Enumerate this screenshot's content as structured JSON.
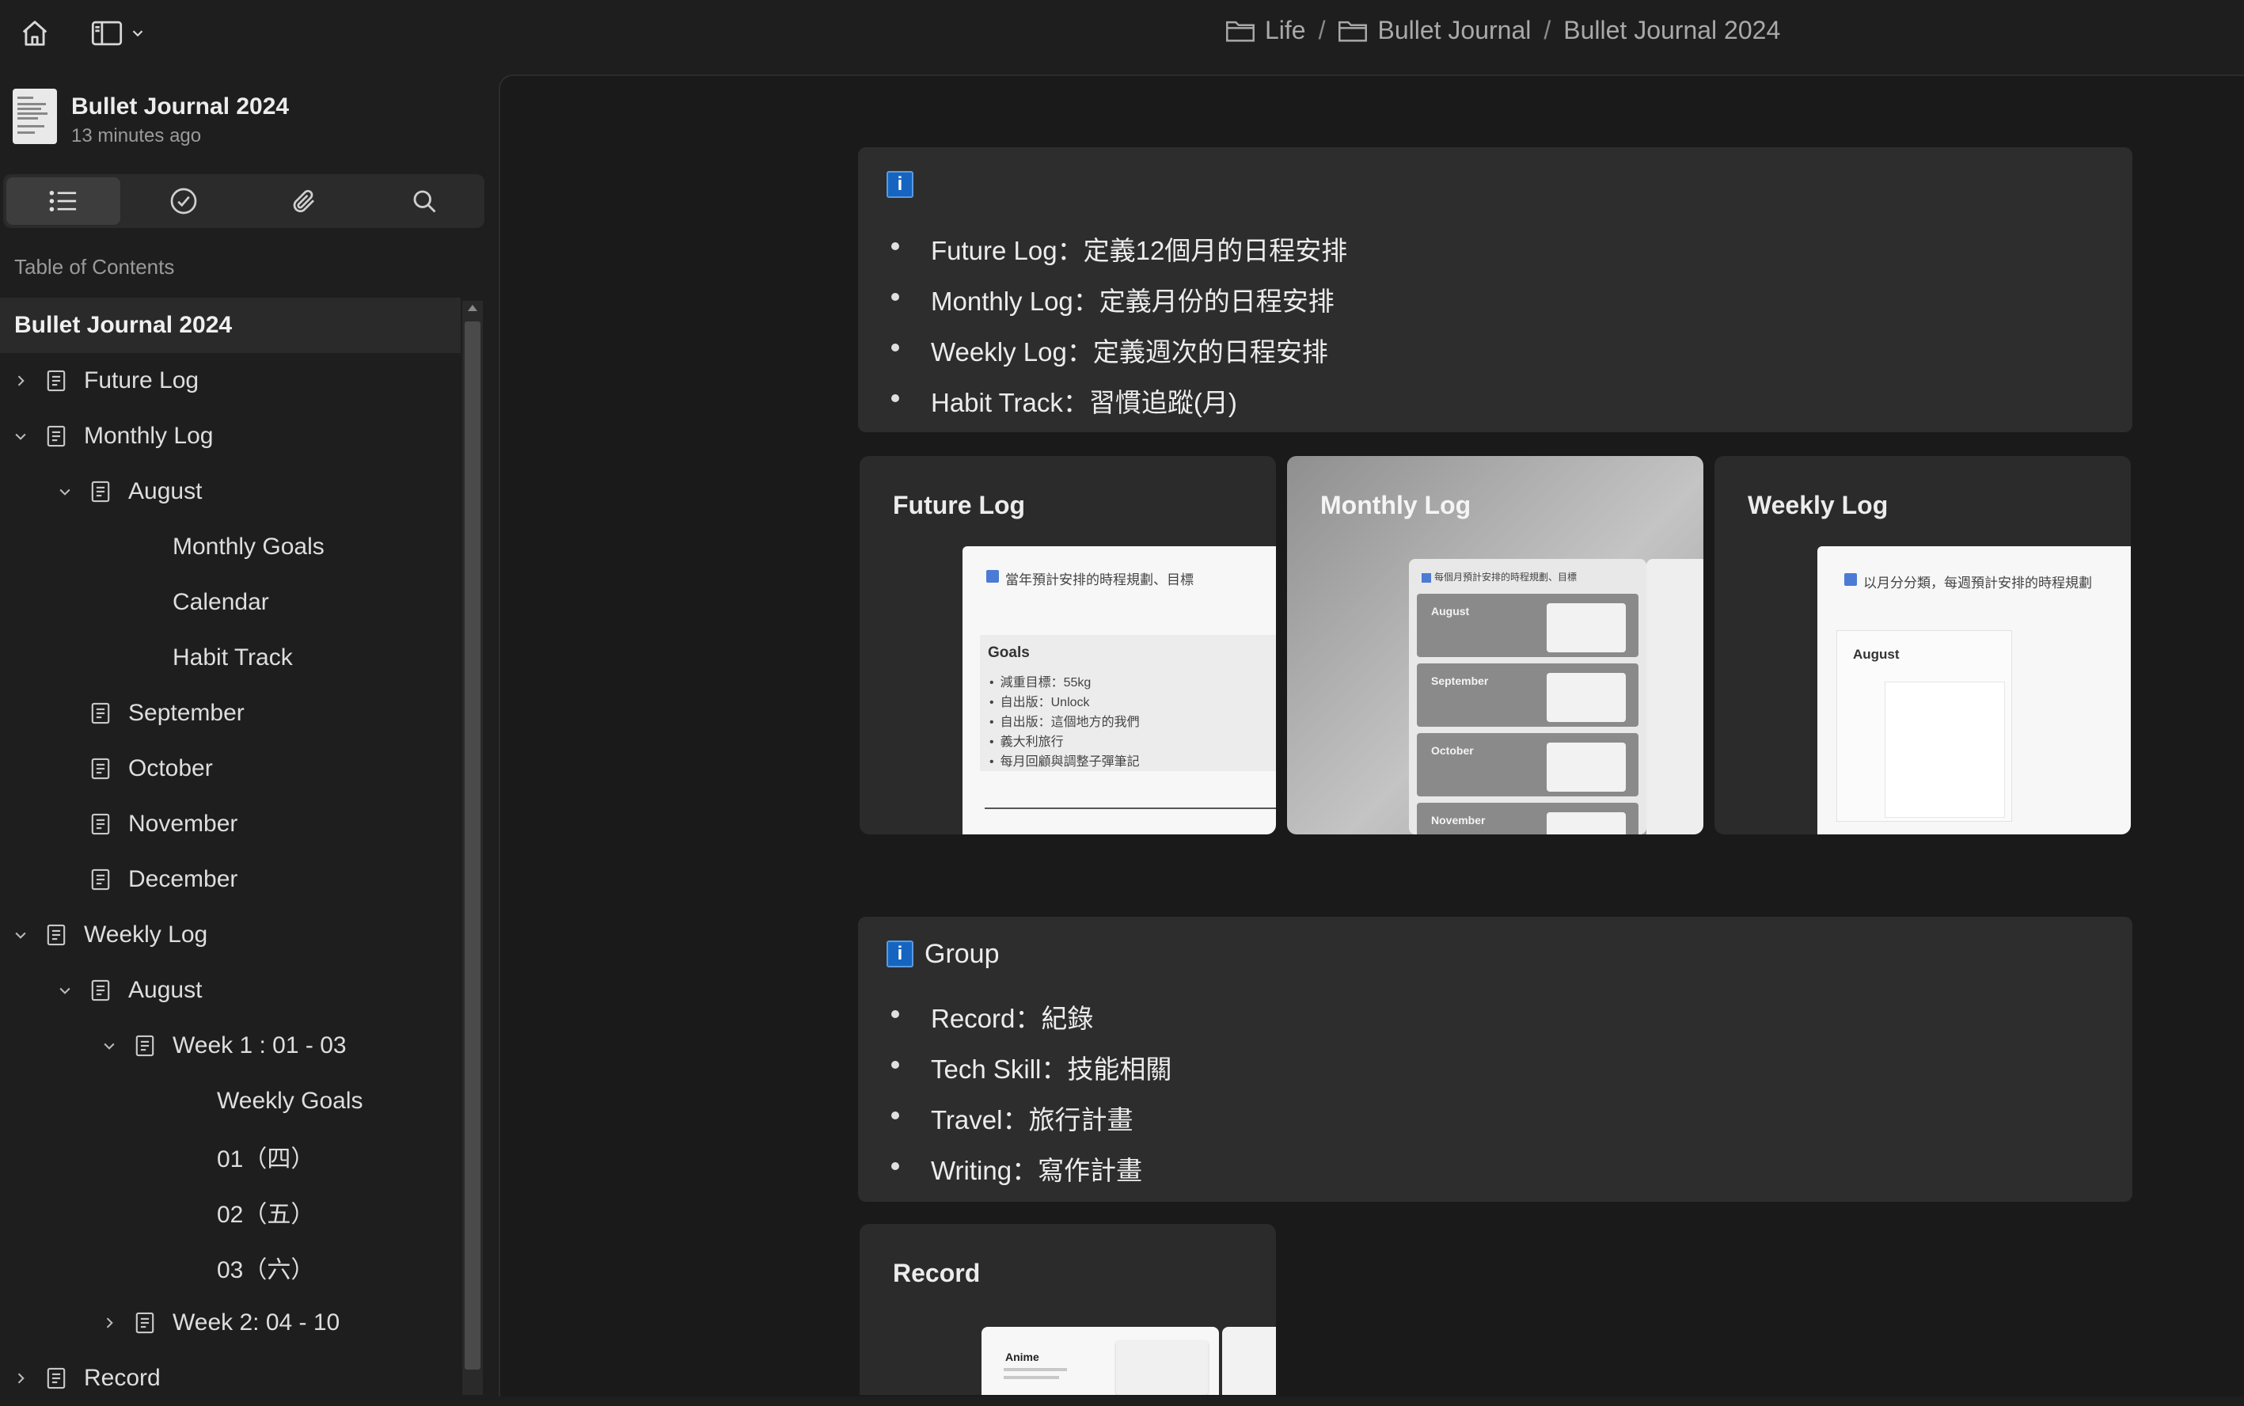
{
  "breadcrumb": [
    "Life",
    "Bullet Journal",
    "Bullet Journal 2024"
  ],
  "document": {
    "title": "Bullet Journal 2024",
    "updated": "13 minutes ago"
  },
  "sidebar": {
    "toc_label": "Table of Contents",
    "tabs": [
      "list-icon",
      "check-circle-icon",
      "paperclip-icon",
      "search-icon"
    ],
    "items": [
      {
        "label": "Bullet Journal 2024",
        "depth": 0,
        "expand": "none",
        "icon": false
      },
      {
        "label": "Future Log",
        "depth": 1,
        "expand": "collapsed",
        "icon": true
      },
      {
        "label": "Monthly Log",
        "depth": 1,
        "expand": "expanded",
        "icon": true
      },
      {
        "label": "August",
        "depth": 2,
        "expand": "expanded",
        "icon": true
      },
      {
        "label": "Monthly Goals",
        "depth": 3,
        "expand": "none",
        "icon": false
      },
      {
        "label": "Calendar",
        "depth": 3,
        "expand": "none",
        "icon": false
      },
      {
        "label": "Habit Track",
        "depth": 3,
        "expand": "none",
        "icon": false
      },
      {
        "label": "September",
        "depth": 2,
        "expand": "none",
        "icon": true
      },
      {
        "label": "October",
        "depth": 2,
        "expand": "none",
        "icon": true
      },
      {
        "label": "November",
        "depth": 2,
        "expand": "none",
        "icon": true
      },
      {
        "label": "December",
        "depth": 2,
        "expand": "none",
        "icon": true
      },
      {
        "label": "Weekly Log",
        "depth": 1,
        "expand": "expanded",
        "icon": true
      },
      {
        "label": "August",
        "depth": 2,
        "expand": "expanded",
        "icon": true
      },
      {
        "label": "Week 1 : 01 - 03",
        "depth": 3,
        "expand": "expanded",
        "icon": true
      },
      {
        "label": "Weekly Goals",
        "depth": 4,
        "expand": "none",
        "icon": false
      },
      {
        "label": "01（四）",
        "depth": 4,
        "expand": "none",
        "icon": false
      },
      {
        "label": "02（五）",
        "depth": 4,
        "expand": "none",
        "icon": false
      },
      {
        "label": "03（六）",
        "depth": 4,
        "expand": "none",
        "icon": false
      },
      {
        "label": "Week 2: 04 - 10",
        "depth": 3,
        "expand": "collapsed",
        "icon": true
      },
      {
        "label": "Record",
        "depth": 1,
        "expand": "collapsed",
        "icon": true
      }
    ]
  },
  "callout1": {
    "badge": "i",
    "items": [
      "Future Log：定義12個月的日程安排",
      "Monthly Log：定義月份的日程安排",
      "Weekly Log：定義週次的日程安排",
      "Habit Track：習慣追蹤(月)"
    ]
  },
  "cards": [
    {
      "title": "Future Log",
      "preview_header": "當年預計安排的時程規劃、目標",
      "goals_title": "Goals",
      "goals": [
        "減重目標：55kg",
        "自出版：Unlock",
        "自出版：這個地方的我們",
        "義大利旅行",
        "每月回顧與調整子彈筆記"
      ]
    },
    {
      "title": "Monthly Log",
      "preview_header": "每個月預計安排的時程規劃、目標",
      "sections": [
        "August",
        "September",
        "October",
        "November"
      ]
    },
    {
      "title": "Weekly Log",
      "preview_header": "以月分分類，每週預計安排的時程規劃",
      "section": "August"
    }
  ],
  "callout2": {
    "badge": "i",
    "title": "Group",
    "items": [
      "Record：紀錄",
      "Tech Skill：技能相關",
      "Travel：旅行計畫",
      "Writing：寫作計畫"
    ]
  },
  "record_card": {
    "title": "Record",
    "preview_label": "Anime"
  }
}
